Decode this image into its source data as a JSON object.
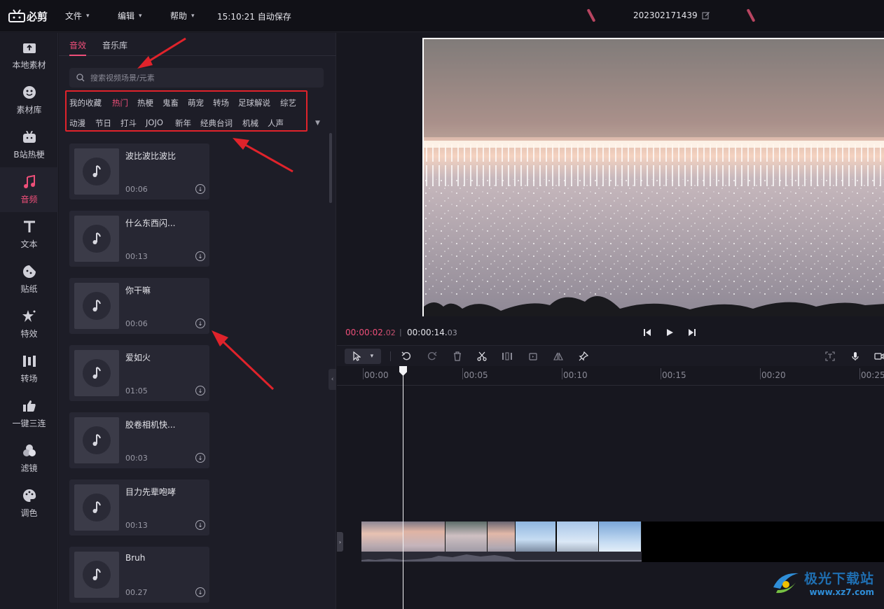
{
  "app": {
    "logo_text": "必剪",
    "autosave": "15:10:21 自动保存",
    "project_title": "202302171439"
  },
  "menu": [
    {
      "label": "文件"
    },
    {
      "label": "编辑"
    },
    {
      "label": "帮助"
    }
  ],
  "nav": [
    {
      "label": "本地素材",
      "icon": "folder-upload-icon"
    },
    {
      "label": "素材库",
      "icon": "smiley-icon"
    },
    {
      "label": "B站热梗",
      "icon": "bilibili-tv-icon"
    },
    {
      "label": "音频",
      "icon": "music-note-icon",
      "active": true
    },
    {
      "label": "文本",
      "icon": "text-t-icon"
    },
    {
      "label": "贴纸",
      "icon": "sticker-icon"
    },
    {
      "label": "特效",
      "icon": "star-effect-icon"
    },
    {
      "label": "转场",
      "icon": "transition-icon"
    },
    {
      "label": "一键三连",
      "icon": "thumbs-up-icon"
    },
    {
      "label": "滤镜",
      "icon": "filter-circles-icon"
    },
    {
      "label": "调色",
      "icon": "palette-icon"
    }
  ],
  "panel": {
    "tabs": [
      {
        "label": "音效",
        "active": true
      },
      {
        "label": "音乐库"
      }
    ],
    "search_placeholder": "搜索视频场景/元素",
    "categories_row1": [
      "我的收藏",
      "热门",
      "热梗",
      "鬼畜",
      "萌宠",
      "转场",
      "足球解说",
      "综艺"
    ],
    "categories_row2": [
      "动漫",
      "节日",
      "打斗",
      "JOJO",
      "新年",
      "经典台词",
      "机械",
      "人声"
    ],
    "active_category": "热门",
    "sounds": [
      {
        "title": "波比波比波比",
        "duration": "00:06"
      },
      {
        "title": "什么东西闪...",
        "duration": "00:13"
      },
      {
        "title": "你干嘛",
        "duration": "00:06"
      },
      {
        "title": "爱如火",
        "duration": "01:05"
      },
      {
        "title": "胶卷相机快...",
        "duration": "00:03"
      },
      {
        "title": "目力先辈咆哮",
        "duration": "00:13"
      },
      {
        "title": "Bruh",
        "duration": "00.27"
      }
    ]
  },
  "player": {
    "current_main": "00:00:02.",
    "current_frac": "02",
    "separator": "|",
    "total_main": "00:00:14.",
    "total_frac": "03"
  },
  "timeline": {
    "ruler_labels": [
      "00:00",
      "00:05",
      "00:10",
      "00:15",
      "00:20",
      "00:25"
    ]
  },
  "watermark": {
    "name": "极光下载站",
    "url": "www.xz7.com"
  },
  "colors": {
    "accent": "#ee4f79",
    "annotation": "#e0232b"
  }
}
